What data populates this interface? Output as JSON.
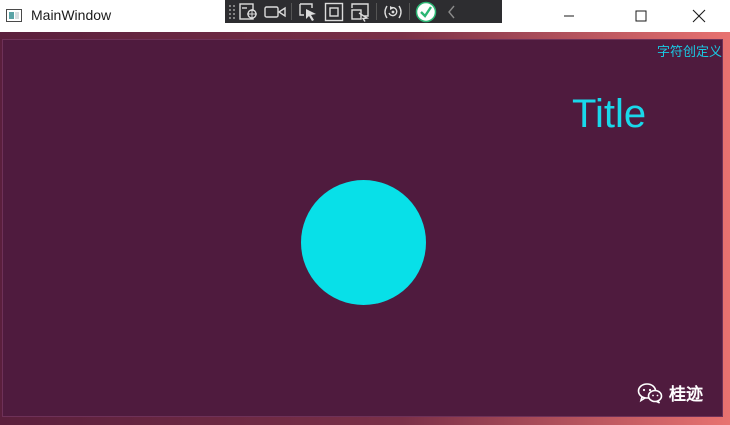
{
  "window": {
    "title": "MainWindow",
    "icons": {
      "app": "app-window-icon",
      "minimize": "minimize-icon",
      "maximize": "maximize-icon",
      "close": "close-icon"
    }
  },
  "debug_toolbar": {
    "buttons": [
      {
        "icon": "go-to-live-visual-tree-icon"
      },
      {
        "icon": "record-icon"
      },
      {
        "icon": "select-element-icon"
      },
      {
        "icon": "display-layout-adorners-icon"
      },
      {
        "icon": "track-focus-icon"
      },
      {
        "icon": "hot-reload-icon"
      },
      {
        "icon": "checkmark-icon",
        "color": "#2bb673"
      },
      {
        "icon": "collapse-chevron-icon"
      }
    ]
  },
  "canvas": {
    "corner_text": "字符创定义",
    "title": "Title",
    "shape_color": "#08e0e8",
    "background_color": "#4f1b3e",
    "text_color": "#19d8ea"
  },
  "brand": {
    "icon": "wechat-icon",
    "text": "桂迹"
  }
}
